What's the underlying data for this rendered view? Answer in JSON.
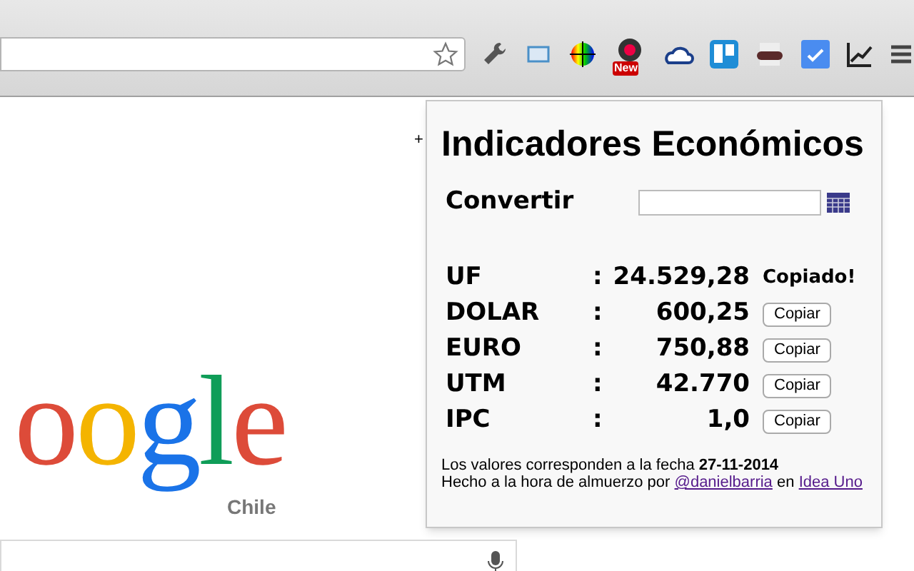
{
  "toolbar": {
    "new_badge": "New"
  },
  "page": {
    "plus": "+",
    "logo": [
      {
        "text": "oogle"
      }
    ],
    "logo_region": "Chile"
  },
  "popup": {
    "title": "Indicadores Económicos",
    "convert": {
      "label": "Convertir"
    },
    "rows": [
      {
        "name": "UF",
        "sep": ":",
        "value": "24.529,28",
        "action": {
          "kind": "status",
          "text": "Copiado!"
        }
      },
      {
        "name": "DOLAR",
        "sep": ":",
        "value": "600,25",
        "action": {
          "kind": "button",
          "text": "Copiar"
        }
      },
      {
        "name": "EURO",
        "sep": ":",
        "value": "750,88",
        "action": {
          "kind": "button",
          "text": "Copiar"
        }
      },
      {
        "name": "UTM",
        "sep": ":",
        "value": "42.770",
        "action": {
          "kind": "button",
          "text": "Copiar"
        }
      },
      {
        "name": "IPC",
        "sep": ":",
        "value": "1,0",
        "action": {
          "kind": "button",
          "text": "Copiar"
        }
      }
    ],
    "footer": {
      "line1": "Los valores corresponden a la fecha **27-11-2014**",
      "line2_prefix": "Hecho a la hora de almuerzo por",
      "author_link": "@danielbarria",
      "middle": "en",
      "org_link": "Idea Uno"
    }
  }
}
